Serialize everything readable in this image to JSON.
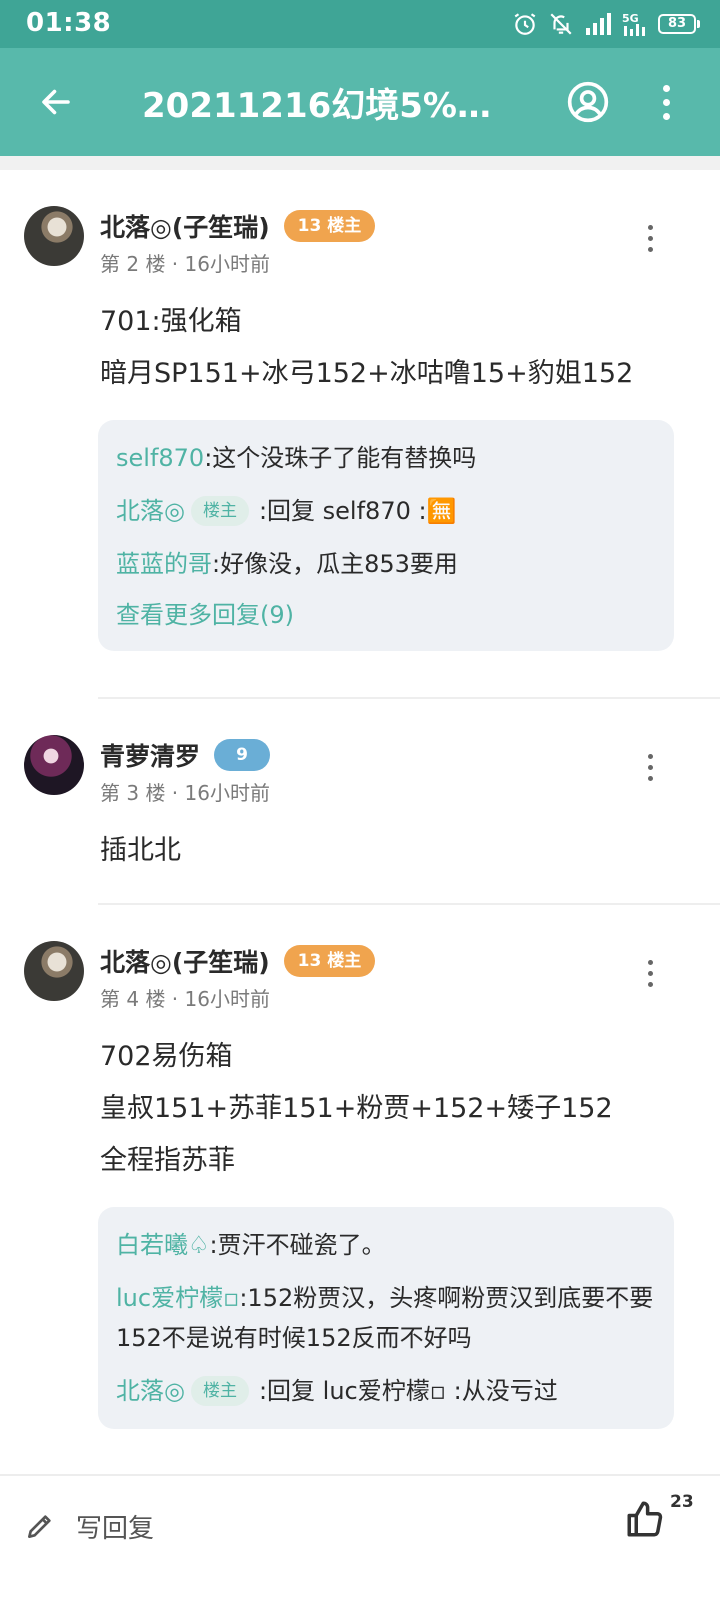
{
  "status_bar": {
    "time": "01:38",
    "signal_tag": "5G",
    "battery": "83",
    "icons": [
      "alarm-icon",
      "bell-off-icon",
      "signal-icon",
      "network-5g-icon",
      "battery-icon"
    ]
  },
  "app_bar": {
    "title": "20211216幻境5%…",
    "icons": [
      "back-arrow-icon",
      "account-icon",
      "more-vert-icon"
    ]
  },
  "floors": [
    {
      "user": "北落◎(子笙瑞)",
      "badge": "13 楼主",
      "meta": "第 2 楼 · 16小时前",
      "lines": [
        "701:强化箱",
        "暗月SP151+冰弓152+冰咕噜15+豹姐152"
      ],
      "replies": [
        {
          "name": "self870",
          "text": ":这个没珠子了能有替换吗"
        },
        {
          "name": "北落◎",
          "tag": "楼主",
          "text": ":回复 self870 :🈚"
        },
        {
          "name": "蓝蓝的哥",
          "text": ":好像没，瓜主853要用"
        }
      ],
      "more_replies": "查看更多回复(9)"
    },
    {
      "user": "青萝清罗",
      "badge": "9",
      "meta": "第 3 楼 · 16小时前",
      "lines": [
        "插北北"
      ]
    },
    {
      "user": "北落◎(子笙瑞)",
      "badge": "13 楼主",
      "meta": "第 4 楼 · 16小时前",
      "lines": [
        "702易伤箱",
        "皇叔151+苏菲151+粉贾+152+矮子152",
        "全程指苏菲"
      ],
      "replies": [
        {
          "name": "白若曦♤",
          "text": ":贾汗不碰瓷了。"
        },
        {
          "name": "luc爱柠檬▫",
          "text": ":152粉贾汉，头疼啊粉贾汉到底要不要152不是说有时候152反而不好吗"
        },
        {
          "name": "北落◎",
          "tag": "楼主",
          "text": ":回复 luc爱柠檬▫ :从没亏过"
        }
      ]
    }
  ],
  "bottom_bar": {
    "write_label": "写回复",
    "like_count": "23",
    "icons": [
      "pencil-icon",
      "thumbs-up-icon"
    ]
  },
  "colors": {
    "status_bar": "#3fa596",
    "app_bar": "#58b9ab",
    "accent": "#4fb3a4",
    "owner_badge": "#f0a44e",
    "level_badge": "#6aaed6",
    "reply_box": "#eef1f5"
  }
}
